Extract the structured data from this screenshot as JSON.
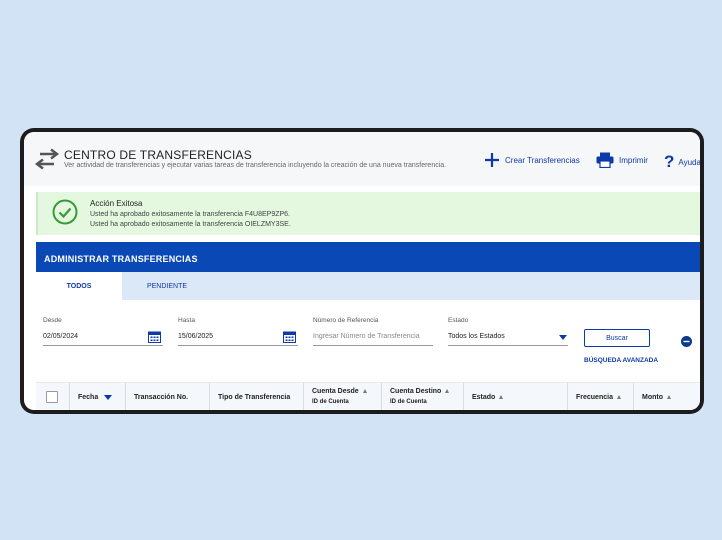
{
  "header": {
    "title": "CENTRO DE TRANSFERENCIAS",
    "subtitle": "Ver actividad de transferencias y ejecutar varias tareas de transferencia incluyendo la creación de una nueva transferencia.",
    "actions": {
      "create": "Crear Transferencias",
      "print": "Imprimir",
      "help": "Ayuda"
    }
  },
  "alert": {
    "title": "Acción Exitosa",
    "lines": [
      "Usted ha aprobado exitosamente la transferencia F4U8EP9ZP6.",
      "Usted ha aprobado exitosamente la transferencia OIELZMY3SE."
    ]
  },
  "panel": {
    "title": "ADMINISTRAR TRANSFERENCIAS",
    "tabs": [
      {
        "label": "TODOS",
        "active": true
      },
      {
        "label": "PENDIENTE",
        "active": false
      }
    ]
  },
  "filters": {
    "desde": {
      "label": "Desde",
      "value": "02/05/2024"
    },
    "hasta": {
      "label": "Hasta",
      "value": "15/06/2025"
    },
    "referencia": {
      "label": "Número de Referencia",
      "placeholder": "Ingresar Número de Transferencia"
    },
    "estado": {
      "label": "Estado",
      "value": "Todos los Estados"
    },
    "search_button": "Buscar",
    "advanced_link": "BÚSQUEDA AVANZADA"
  },
  "table": {
    "columns": {
      "fecha": "Fecha",
      "transaccion": "Transacción No.",
      "tipo": "Tipo de Transferencia",
      "cuenta_desde": "Cuenta Desde",
      "cuenta_desde_sub": "ID de Cuenta",
      "cuenta_destino": "Cuenta Destino",
      "cuenta_destino_sub": "ID de Cuenta",
      "estado": "Estado",
      "frecuencia": "Frecuencia",
      "monto": "Monto"
    }
  },
  "colors": {
    "brand_blue": "#0a49b5",
    "link_blue": "#0d3aa8",
    "success_bg": "#e3f8df",
    "success_icon": "#3a9a3a"
  },
  "icons": [
    "transfer-arrows-icon",
    "plus-icon",
    "printer-icon",
    "help-icon",
    "check-circle-icon",
    "calendar-icon",
    "chevron-down-icon",
    "collapse-icon",
    "sort-icon"
  ]
}
